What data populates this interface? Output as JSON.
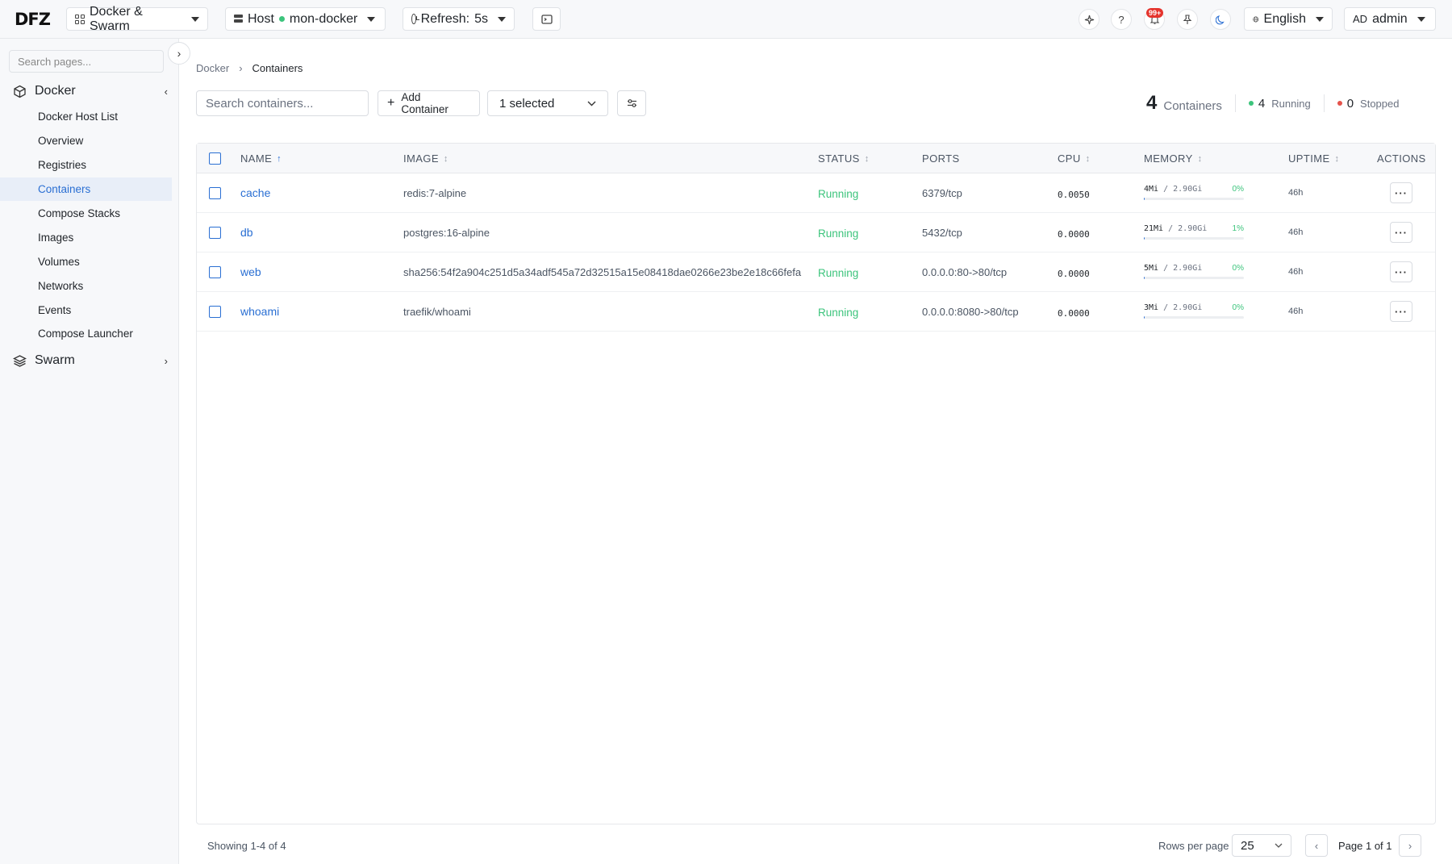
{
  "topbar": {
    "logo": "DFZ",
    "scope_label": "Docker & Swarm",
    "host_prefix": "Host",
    "host_name": "mon-docker",
    "refresh_label": "Refresh:",
    "refresh_value": "5s",
    "notif_badge": "99+",
    "help_glyph": "?",
    "language": "English",
    "user_initials": "AD",
    "user_name": "admin",
    "icons": [
      "grid-icon",
      "server-icon",
      "clock-icon",
      "terminal-icon",
      "sparkle-icon",
      "help-icon",
      "bell-icon",
      "pin-icon",
      "moon-icon",
      "globe-icon"
    ]
  },
  "sidebar": {
    "search_placeholder": "Search pages...",
    "collapse_glyph": "›",
    "groups": [
      {
        "label": "Docker",
        "expanded": true,
        "chevron": "‹"
      },
      {
        "label": "Swarm",
        "expanded": false,
        "chevron": "›"
      }
    ],
    "items": [
      {
        "label": "Docker Host List",
        "active": false
      },
      {
        "label": "Overview",
        "active": false
      },
      {
        "label": "Registries",
        "active": false
      },
      {
        "label": "Containers",
        "active": true
      },
      {
        "label": "Compose Stacks",
        "active": false
      },
      {
        "label": "Images",
        "active": false
      },
      {
        "label": "Volumes",
        "active": false
      },
      {
        "label": "Networks",
        "active": false
      },
      {
        "label": "Events",
        "active": false
      },
      {
        "label": "Compose Launcher",
        "active": false
      }
    ]
  },
  "breadcrumb": {
    "parent": "Docker",
    "separator": "›",
    "current": "Containers"
  },
  "toolbar": {
    "search_placeholder": "Search containers...",
    "add_label": "Add Container",
    "add_glyph": "+",
    "select_value": "1 selected"
  },
  "stats": {
    "total": "4",
    "total_label": "Containers",
    "running": "4",
    "running_label": "Running",
    "stopped": "0",
    "stopped_label": "Stopped",
    "running_color": "#3cc47c",
    "stopped_color": "#e5534b"
  },
  "table": {
    "headers": {
      "name": "NAME",
      "image": "IMAGE",
      "status": "STATUS",
      "ports": "PORTS",
      "cpu": "CPU",
      "memory": "MEMORY",
      "uptime": "UPTIME",
      "actions": "ACTIONS"
    },
    "sort_glyph_active": "↑",
    "sort_glyph": "↕",
    "action_glyph": "···",
    "rows": [
      {
        "name": "cache",
        "image": "redis:7-alpine",
        "status": "Running",
        "ports": "6379/tcp",
        "cpu": "0.0050",
        "mem_used": "4Mi",
        "mem_limit": "/ 2.90Gi",
        "mem_pct": "0%",
        "mem_fraction": 0.01,
        "uptime": "46h"
      },
      {
        "name": "db",
        "image": "postgres:16-alpine",
        "status": "Running",
        "ports": "5432/tcp",
        "cpu": "0.0000",
        "mem_used": "21Mi",
        "mem_limit": "/ 2.90Gi",
        "mem_pct": "1%",
        "mem_fraction": 0.01,
        "uptime": "46h"
      },
      {
        "name": "web",
        "image": "sha256:54f2a904c251d5a34adf545a72d32515a15e08418dae0266e23be2e18c66fefa",
        "status": "Running",
        "ports": "0.0.0.0:80->80/tcp",
        "cpu": "0.0000",
        "mem_used": "5Mi",
        "mem_limit": "/ 2.90Gi",
        "mem_pct": "0%",
        "mem_fraction": 0.01,
        "uptime": "46h"
      },
      {
        "name": "whoami",
        "image": "traefik/whoami",
        "status": "Running",
        "ports": "0.0.0.0:8080->80/tcp",
        "cpu": "0.0000",
        "mem_used": "3Mi",
        "mem_limit": "/ 2.90Gi",
        "mem_pct": "0%",
        "mem_fraction": 0.01,
        "uptime": "46h"
      }
    ]
  },
  "footer": {
    "showing": "Showing 1-4 of 4",
    "rows_per_page_label": "Rows per page",
    "rows_per_page": "25",
    "page_info": "Page 1 of 1",
    "prev_glyph": "‹",
    "next_glyph": "›"
  },
  "colors": {
    "accent": "#2a6fd3",
    "running": "#3cc47c",
    "stopped": "#e5534b",
    "badge": "#e5342d"
  }
}
